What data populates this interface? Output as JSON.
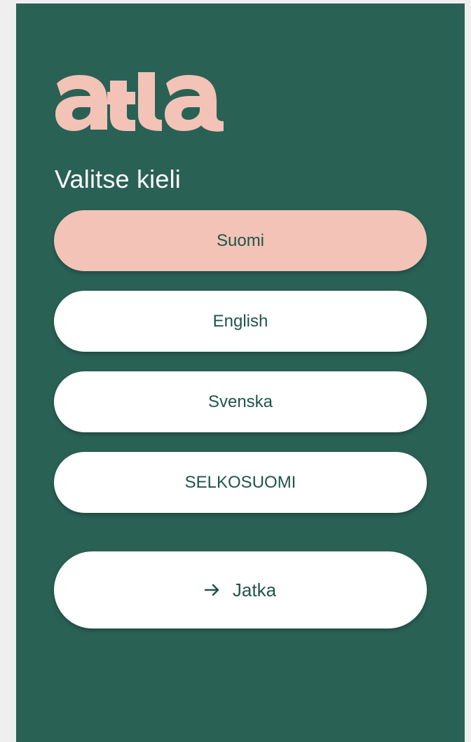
{
  "app": {
    "logo_text": "atla"
  },
  "heading": "Valitse kieli",
  "languages": [
    {
      "label": "Suomi",
      "selected": true
    },
    {
      "label": "English",
      "selected": false
    },
    {
      "label": "Svenska",
      "selected": false
    },
    {
      "label": "SELKOSUOMI",
      "selected": false
    }
  ],
  "continue_button": {
    "label": "Jatka",
    "icon": "arrow-right-icon"
  },
  "colors": {
    "background": "#2a6155",
    "accent": "#f2c3b6",
    "button": "#ffffff",
    "button_text": "#1f5548"
  }
}
